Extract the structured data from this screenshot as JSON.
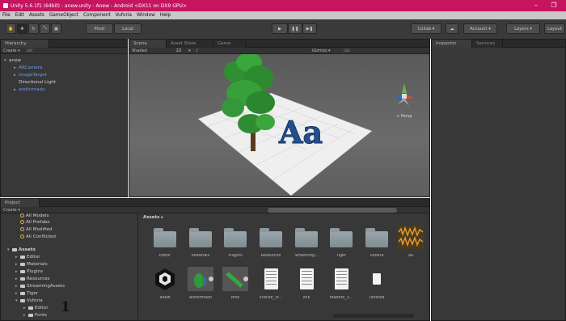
{
  "window": {
    "title": "Unity 5.6.1f1 (64bit) - anew.unity - Anew - Android <DX11 on DX9 GPU>",
    "controls": [
      "–",
      "❐"
    ]
  },
  "menu": [
    "File",
    "Edit",
    "Assets",
    "GameObject",
    "Component",
    "Vuforia",
    "Window",
    "Help"
  ],
  "toolbar": {
    "pivot": "Pivot",
    "local": "Local",
    "collab": "Collab ▾",
    "account": "Account ▾",
    "layers": "Layers ▾",
    "layout": "Layout"
  },
  "hierarchy": {
    "tab": "Hierarchy",
    "create": "Create ▾",
    "search": "(all",
    "scene": "anew",
    "items": [
      {
        "label": "ARCamera",
        "blue": true
      },
      {
        "label": "ImageTarget",
        "blue": true
      },
      {
        "label": "Directional Light",
        "blue": false
      },
      {
        "label": "areformado",
        "blue": true
      }
    ]
  },
  "scene": {
    "tabs": [
      "Scene",
      "Asset Store",
      "Game"
    ],
    "shading": "Shaded",
    "mode": "2D",
    "gizmos": "Gizmos ▾",
    "search": "(all",
    "persp": "< Persp",
    "text3d": "Aa"
  },
  "inspector": {
    "tabs": [
      "Inspector",
      "Services"
    ]
  },
  "project": {
    "tab": "Project",
    "create": "Create ▾",
    "favorites": [
      "All Models",
      "All Prefabs",
      "All Modified",
      "All Conflicted"
    ],
    "assets_root": "Assets",
    "tree": [
      {
        "label": "Editor",
        "level": 1
      },
      {
        "label": "Materials",
        "level": 1
      },
      {
        "label": "Plugins",
        "level": 1
      },
      {
        "label": "Resources",
        "level": 1
      },
      {
        "label": "StreamingAssets",
        "level": 1
      },
      {
        "label": "Tiger",
        "level": 1
      },
      {
        "label": "Vuforia",
        "level": 1
      },
      {
        "label": "Editor",
        "level": 2
      },
      {
        "label": "Fonts",
        "level": 2
      }
    ],
    "breadcrumb": "Assets ▸",
    "row1": [
      {
        "label": "Editor",
        "type": "folder"
      },
      {
        "label": "Materials",
        "type": "folder"
      },
      {
        "label": "Plugins",
        "type": "folder"
      },
      {
        "label": "Resources",
        "type": "folder"
      },
      {
        "label": "Streaming...",
        "type": "folder"
      },
      {
        "label": "Tiger",
        "type": "folder"
      },
      {
        "label": "Vuforia",
        "type": "folder"
      },
      {
        "label": "aa",
        "type": "audio"
      }
    ],
    "row2": [
      {
        "label": "anew",
        "type": "unity"
      },
      {
        "label": "areformado",
        "type": "model"
      },
      {
        "label": "bros",
        "type": "model2"
      },
      {
        "label": "license_3r...",
        "type": "doc"
      },
      {
        "label": "link",
        "type": "doc"
      },
      {
        "label": "readme_3...",
        "type": "doc"
      },
      {
        "label": "untitled",
        "type": "blank"
      }
    ]
  },
  "overlay_number": "1",
  "colors": {
    "titlebar": "#c5155f",
    "panel": "#383838",
    "selected_text": "#6c9ce8"
  }
}
